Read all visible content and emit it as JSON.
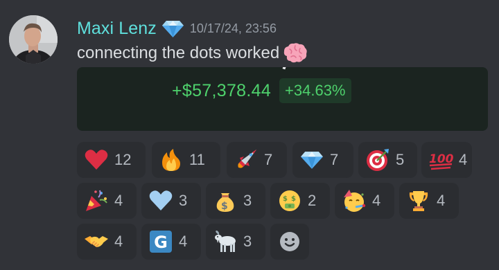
{
  "message": {
    "username": "Maxi Lenz",
    "timestamp": "10/17/24, 23:56",
    "text": "connecting the dots worked",
    "embed": {
      "amount": "+$57,378.44",
      "percent": "+34.63%"
    }
  },
  "colors": {
    "username": "#5fe0dd",
    "positive": "#4ed16c",
    "background": "#313338",
    "reaction_bg": "#2b2d31"
  },
  "reactions": [
    {
      "icon": "red-heart-icon",
      "count": "12"
    },
    {
      "icon": "fire-icon",
      "count": "11"
    },
    {
      "icon": "rocket-icon",
      "count": "7"
    },
    {
      "icon": "gem-icon",
      "count": "7"
    },
    {
      "icon": "direct-hit-icon",
      "count": "5"
    },
    {
      "icon": "hundred-points-icon",
      "count": "4"
    },
    {
      "icon": "party-popper-icon",
      "count": "4"
    },
    {
      "icon": "blue-heart-icon",
      "count": "3"
    },
    {
      "icon": "money-bag-icon",
      "count": "3"
    },
    {
      "icon": "money-mouth-face-icon",
      "count": "2"
    },
    {
      "icon": "partying-face-icon",
      "count": "4"
    },
    {
      "icon": "trophy-icon",
      "count": "4"
    },
    {
      "icon": "handshake-icon",
      "count": "4"
    },
    {
      "icon": "letter-g-icon",
      "count": "4"
    },
    {
      "icon": "goat-icon",
      "count": "3"
    }
  ],
  "add_reaction": {
    "icon": "add-reaction-smiley-icon"
  }
}
